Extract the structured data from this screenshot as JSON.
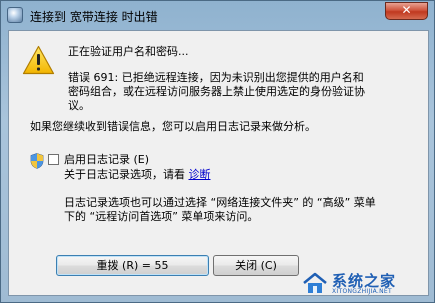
{
  "window": {
    "title": "连接到 宽带连接 时出错",
    "close_label": "✕"
  },
  "dialog": {
    "status_text": "正在验证用户名和密码...",
    "error_line1": "错误 691: 已拒绝远程连接，因为未识别出您提供的用户名和",
    "error_line2": "密码组合，或在远程访问服务器上禁止使用选定的身份验证协",
    "error_line3": "议。",
    "hint": "如果您继续收到错误信息，您可以启用日志记录来做分析。",
    "logging_checkbox_label": "启用日志记录 (E)",
    "logging_checked": false,
    "info_prefix": "关于日志记录选项，请看",
    "info_link": "诊断",
    "note_line1": "日志记录选项也可以通过选择 “网络连接文件夹” 的 “高级” 菜单",
    "note_line2": "下的 “远程访问首选项” 菜单项来访问。"
  },
  "buttons": {
    "redial": "重拨 (R) = 55",
    "close": "关闭 (C)"
  },
  "watermark": {
    "main": "系统之家",
    "sub": "XITONGZHIJIA.NET"
  },
  "colors": {
    "accent": "#3c7fb1",
    "warning": "#f5c400",
    "link": "#0000cc"
  }
}
